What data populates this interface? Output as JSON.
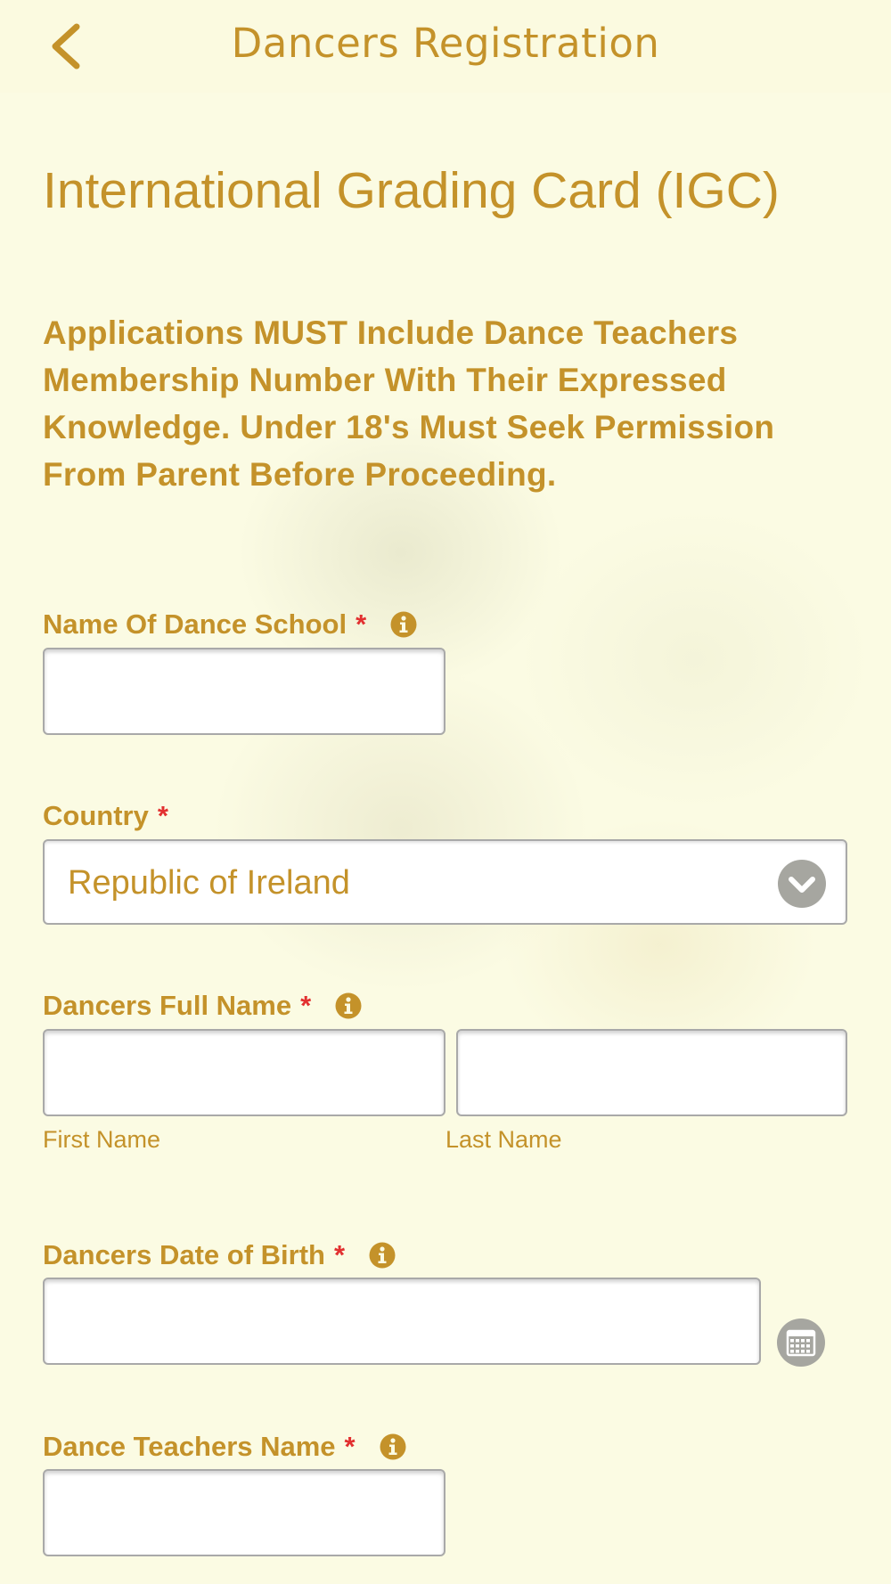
{
  "header": {
    "title": "Dancers Registration",
    "back_icon": "chevron-left-icon"
  },
  "main": {
    "title": "International Grading Card (IGC)",
    "notice": "Applications MUST Include Dance Teachers Membership Number With Their Expressed Knowledge. Under 18's Must Seek Permission From Parent Before Proceeding."
  },
  "form": {
    "required_marker": "*",
    "dance_school": {
      "label": "Name Of Dance School",
      "value": ""
    },
    "country": {
      "label": "Country",
      "selected": "Republic of Ireland"
    },
    "full_name": {
      "label": "Dancers Full Name",
      "first_name_value": "",
      "last_name_value": "",
      "first_name_sublabel": "First Name",
      "last_name_sublabel": "Last Name"
    },
    "date_of_birth": {
      "label": "Dancers Date of Birth",
      "value": ""
    },
    "teacher_name": {
      "label": "Dance Teachers Name",
      "value": ""
    }
  },
  "colors": {
    "accent": "#c4922a",
    "required": "#e23030",
    "background": "#fbfbe3",
    "icon_gray": "#a6a6a0"
  }
}
